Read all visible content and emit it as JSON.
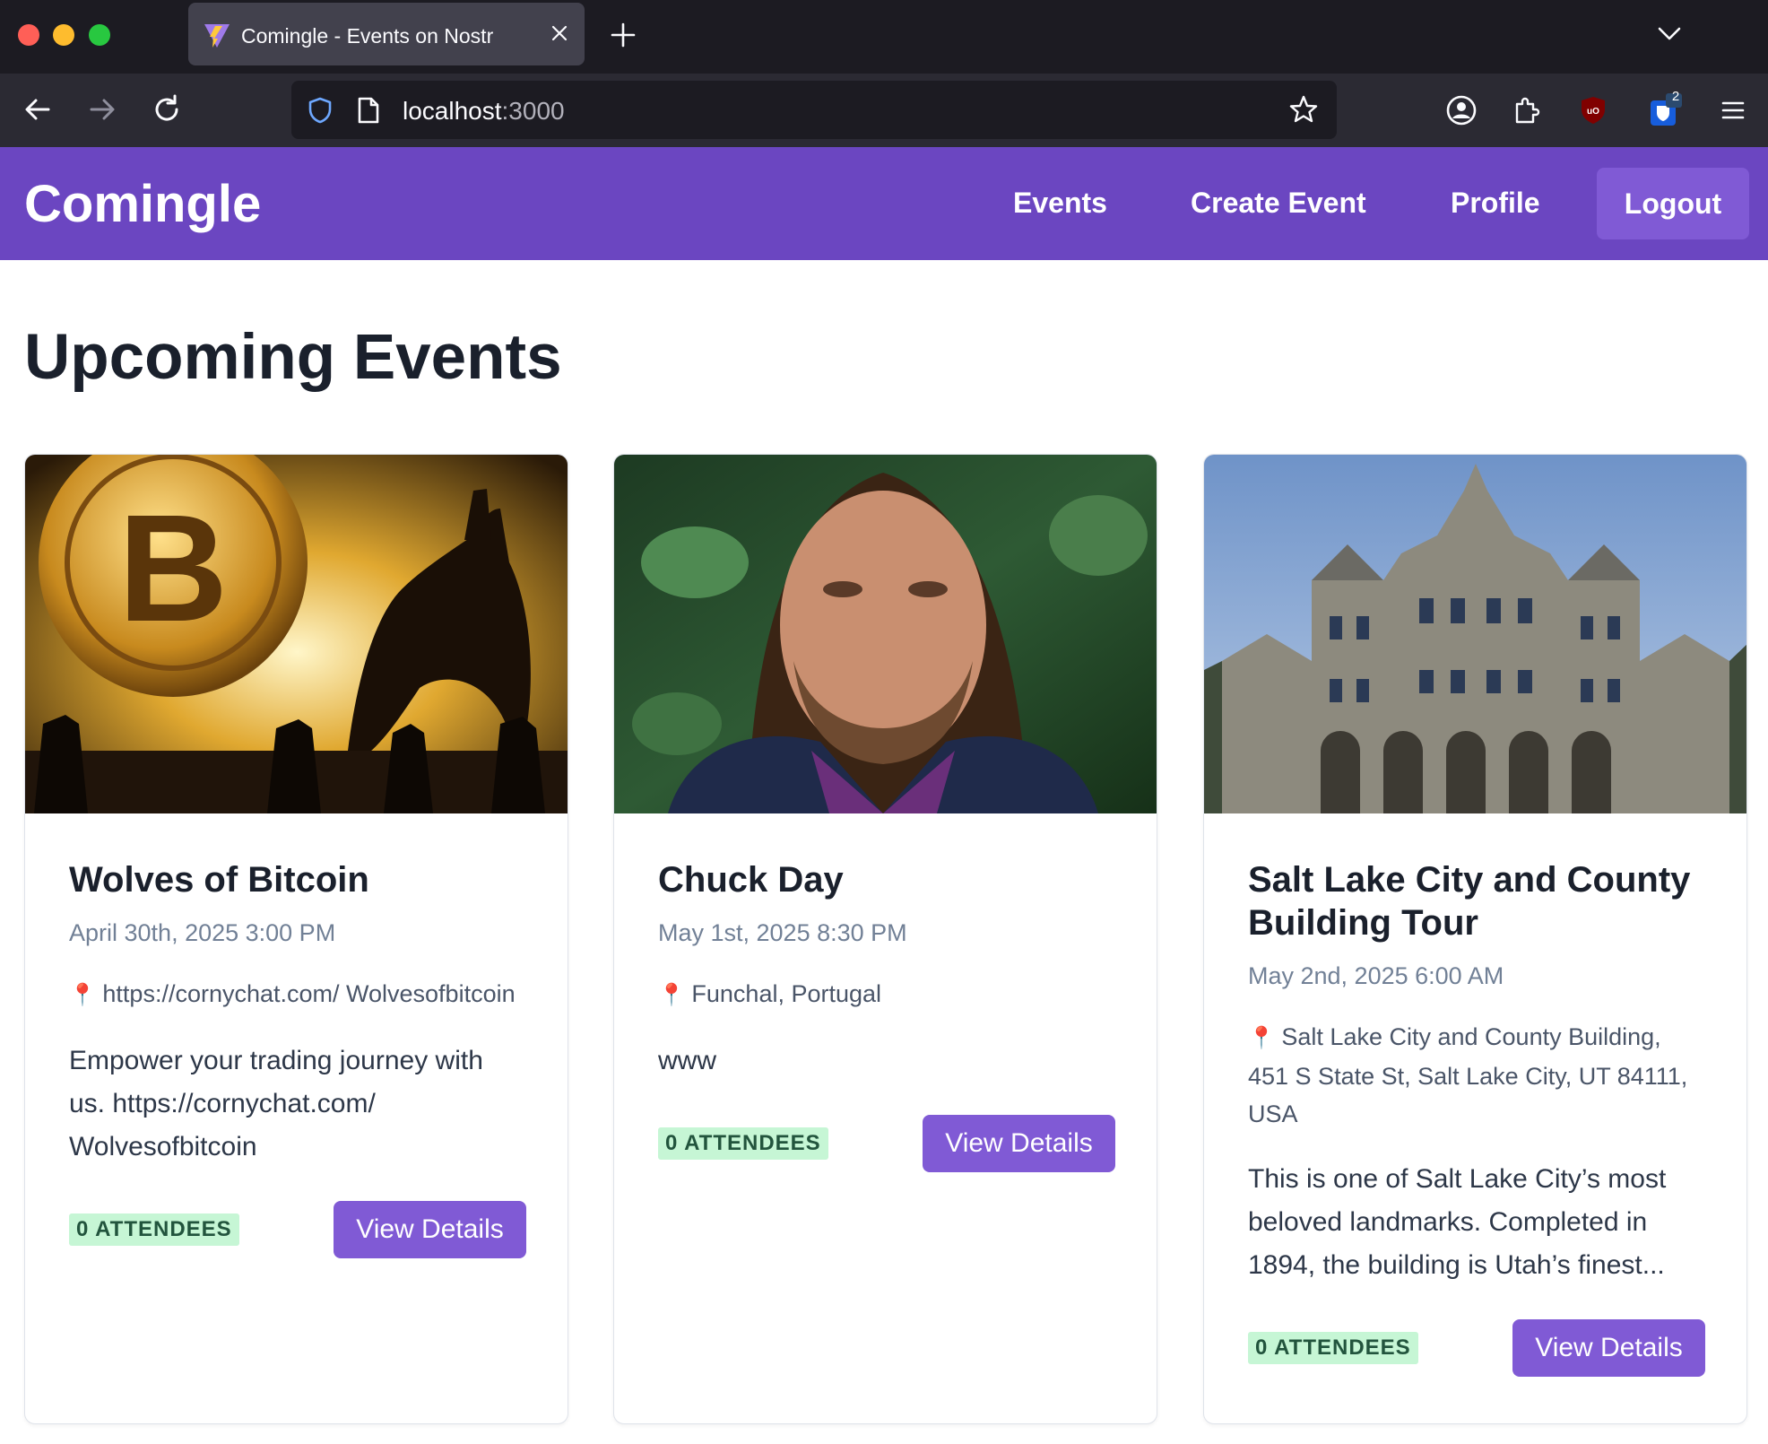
{
  "browser": {
    "tab_title": "Comingle - Events on Nostr",
    "url_host": "localhost",
    "url_port": ":3000",
    "extension_badge": "2"
  },
  "header": {
    "brand": "Comingle",
    "nav": {
      "events": "Events",
      "create_event": "Create Event",
      "profile": "Profile",
      "logout": "Logout"
    },
    "colors": {
      "header_bg": "#6b46c1",
      "button_bg": "#805ad5"
    }
  },
  "page_title": "Upcoming Events",
  "events": [
    {
      "title": "Wolves of Bitcoin",
      "date": "April 30th, 2025 3:00 PM",
      "location": "https://cornychat.com/ Wolvesofbitcoin",
      "description": "Empower your trading journey with us. https://cornychat.com/ Wolvesofbitcoin",
      "attendees": "0 ATTENDEES",
      "button": "View Details"
    },
    {
      "title": "Chuck Day",
      "date": "May 1st, 2025 8:30 PM",
      "location": "Funchal, Portugal",
      "description": "www",
      "attendees": "0 ATTENDEES",
      "button": "View Details"
    },
    {
      "title": "Salt Lake City and County Building Tour",
      "date": "May 2nd, 2025 6:00 AM",
      "location": "Salt Lake City and County Building, 451 S State St, Salt Lake City, UT 84111, USA",
      "description": "This is one of Salt Lake City’s most beloved landmarks. Completed in 1894, the building is Utah’s finest...",
      "attendees": "0 ATTENDEES",
      "button": "View Details"
    }
  ]
}
